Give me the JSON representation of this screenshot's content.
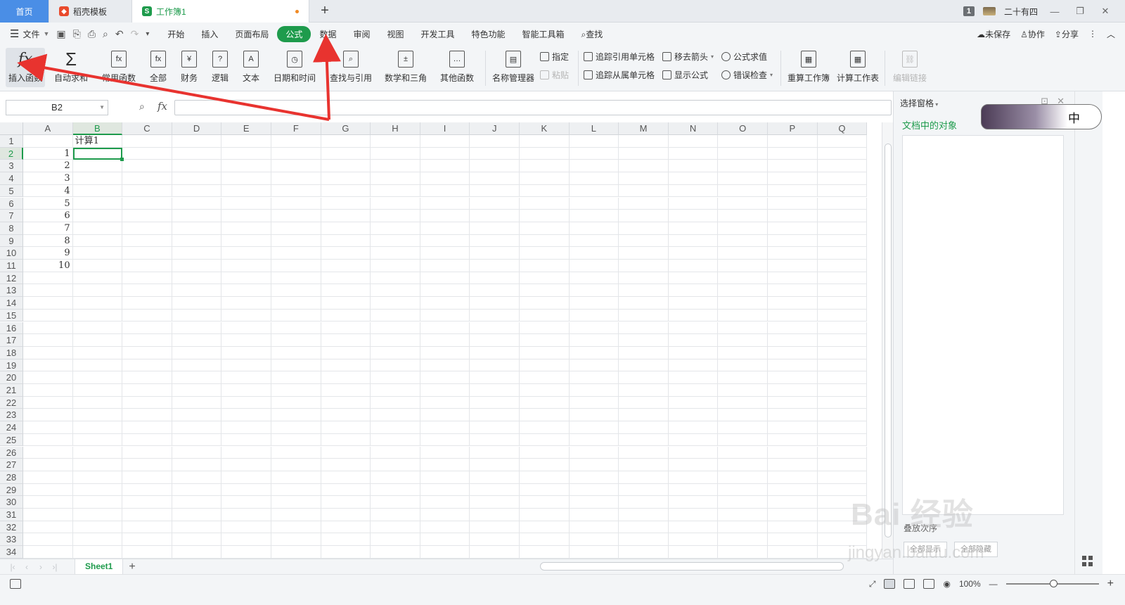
{
  "tabs": {
    "home": "首页",
    "template": "稻壳模板",
    "workbook": "工作簿1",
    "add": "+"
  },
  "titlebar": {
    "badge": "1",
    "user": "二十有四"
  },
  "menu": {
    "file": "文件",
    "items": [
      "开始",
      "插入",
      "页面布局",
      "公式",
      "数据",
      "审阅",
      "视图",
      "开发工具",
      "特色功能",
      "智能工具箱",
      "查找"
    ],
    "active": "公式",
    "right": {
      "save": "未保存",
      "collab": "协作",
      "share": "分享"
    }
  },
  "ribbon": {
    "insert_function": "插入函数",
    "autosum": "自动求和",
    "common": "常用函数",
    "all": "全部",
    "finance": "财务",
    "logic": "逻辑",
    "text": "文本",
    "datetime": "日期和时间",
    "lookup": "查找与引用",
    "math": "数学和三角",
    "other": "其他函数",
    "name_manager": "名称管理器",
    "specify": "指定",
    "paste": "粘贴",
    "trace_precedents": "追踪引用单元格",
    "trace_dependents": "追踪从属单元格",
    "remove_arrows": "移去箭头",
    "show_formulas": "显示公式",
    "evaluate": "公式求值",
    "error_check": "错误检查",
    "recalc_workbook": "重算工作簿",
    "calc_sheet": "计算工作表",
    "edit_links": "编辑链接"
  },
  "formula_bar": {
    "name_box": "B2",
    "fx": "fx",
    "formula": ""
  },
  "grid": {
    "columns": [
      "A",
      "B",
      "C",
      "D",
      "E",
      "F",
      "G",
      "H",
      "I",
      "J",
      "K",
      "L",
      "M",
      "N",
      "O",
      "P",
      "Q"
    ],
    "row_count": 34,
    "selected_cell": "B2",
    "cells": {
      "B1": "计算1",
      "A2": "1",
      "A3": "2",
      "A4": "3",
      "A5": "4",
      "A6": "5",
      "A7": "6",
      "A8": "7",
      "A9": "8",
      "A10": "9",
      "A11": "10"
    }
  },
  "sheets": {
    "active": "Sheet1"
  },
  "pane": {
    "title": "选择窗格",
    "subtitle": "文档中的对象",
    "order": "叠放次序",
    "show_all": "全部显示",
    "hide_all": "全部隐藏"
  },
  "ime": {
    "label": "中"
  },
  "status": {
    "zoom": "100%"
  },
  "watermark": {
    "line1": "Bai 经验",
    "line2": "jingyan.baidu.com"
  },
  "colors": {
    "accent": "#1e9b4c",
    "home_tab": "#4a8ee6",
    "annotation_arrow": "#e8332f"
  }
}
